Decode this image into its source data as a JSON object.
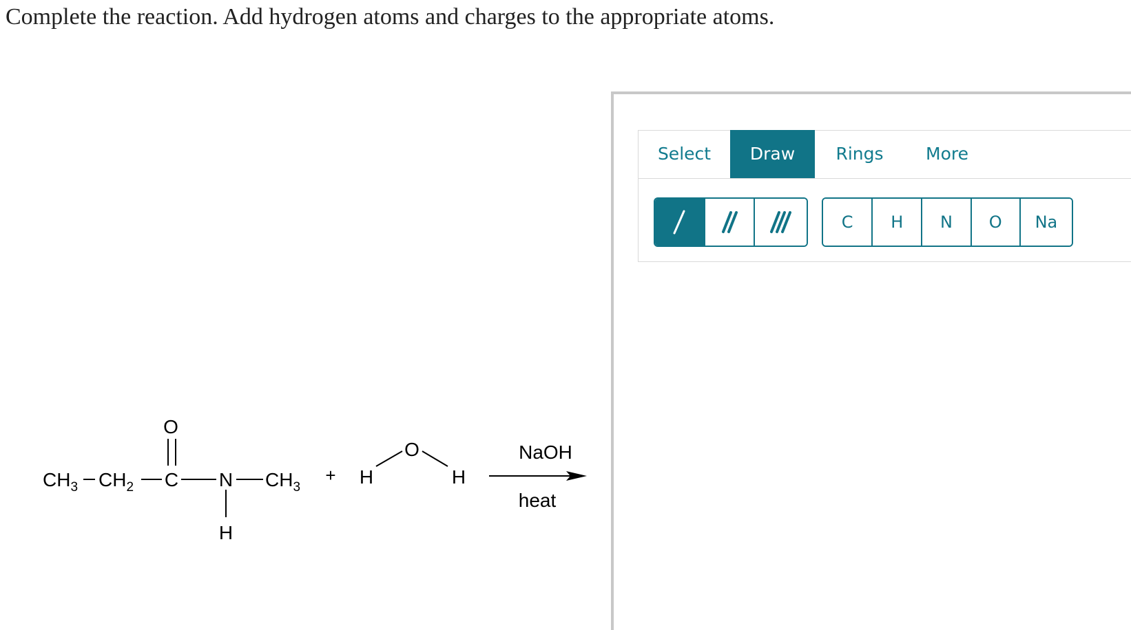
{
  "prompt": "Complete the reaction. Add hydrogen atoms and charges to the appropriate atoms.",
  "reaction": {
    "carbonyl_oxygen": "O",
    "ch3": "CH",
    "ch3_sub": "3",
    "ch2": "CH",
    "ch2_sub": "2",
    "carbonyl_carbon": "C",
    "nitrogen": "N",
    "n_methyl": "CH",
    "n_methyl_sub": "3",
    "n_hydrogen": "H",
    "plus": "+",
    "water_h_left": "H",
    "water_o": "O",
    "water_h_right": "H",
    "reagent": "NaOH",
    "condition": "heat"
  },
  "toolbar": {
    "tabs": [
      {
        "label": "Select"
      },
      {
        "label": "Draw"
      },
      {
        "label": "Rings"
      },
      {
        "label": "More"
      }
    ],
    "active_tab": "Draw",
    "atoms": [
      {
        "label": "C"
      },
      {
        "label": "H"
      },
      {
        "label": "N"
      },
      {
        "label": "O"
      },
      {
        "label": "Na"
      }
    ]
  },
  "colors": {
    "accent": "#117487",
    "tab_text": "#117b8e",
    "panel_border": "#c8c8c8"
  }
}
